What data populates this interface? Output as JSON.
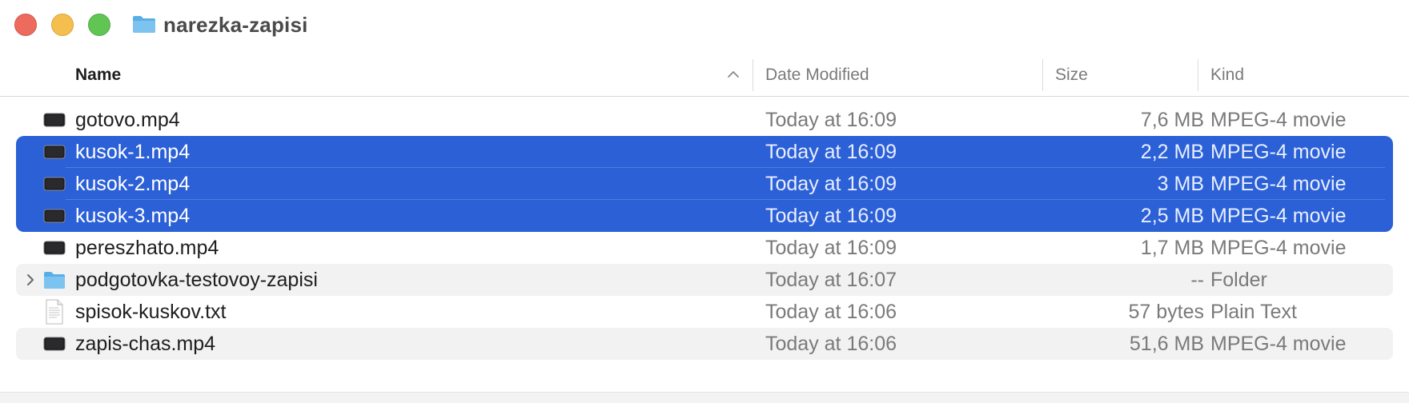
{
  "window": {
    "title": "narezka-zapisi",
    "title_icon": "folder-icon"
  },
  "columns": {
    "name": "Name",
    "date": "Date Modified",
    "size": "Size",
    "kind": "Kind",
    "sort_indicator": "chevron-up-icon"
  },
  "colors": {
    "selection": "#2b60d6",
    "folder": "#6cb8ea",
    "close": "#ed6a5e",
    "minimize": "#f5bf4f",
    "maximize": "#61c554"
  },
  "files": [
    {
      "name": "gotovo.mp4",
      "date": "Today at 16:09",
      "size": "7,6 MB",
      "kind": "MPEG-4 movie",
      "icon": "video-file-icon",
      "selected": false
    },
    {
      "name": "kusok-1.mp4",
      "date": "Today at 16:09",
      "size": "2,2 MB",
      "kind": "MPEG-4 movie",
      "icon": "video-file-icon",
      "selected": true
    },
    {
      "name": "kusok-2.mp4",
      "date": "Today at 16:09",
      "size": "3 MB",
      "kind": "MPEG-4 movie",
      "icon": "video-file-icon",
      "selected": true
    },
    {
      "name": "kusok-3.mp4",
      "date": "Today at 16:09",
      "size": "2,5 MB",
      "kind": "MPEG-4 movie",
      "icon": "video-file-icon",
      "selected": true
    },
    {
      "name": "pereszhato.mp4",
      "date": "Today at 16:09",
      "size": "1,7 MB",
      "kind": "MPEG-4 movie",
      "icon": "video-file-icon",
      "selected": false
    },
    {
      "name": "podgotovka-testovoy-zapisi",
      "date": "Today at 16:07",
      "size": "--",
      "kind": "Folder",
      "icon": "folder-icon",
      "selected": false
    },
    {
      "name": "spisok-kuskov.txt",
      "date": "Today at 16:06",
      "size": "57 bytes",
      "kind": "Plain Text",
      "icon": "text-file-icon",
      "selected": false
    },
    {
      "name": "zapis-chas.mp4",
      "date": "Today at 16:06",
      "size": "51,6 MB",
      "kind": "MPEG-4 movie",
      "icon": "video-file-icon",
      "selected": false
    }
  ]
}
